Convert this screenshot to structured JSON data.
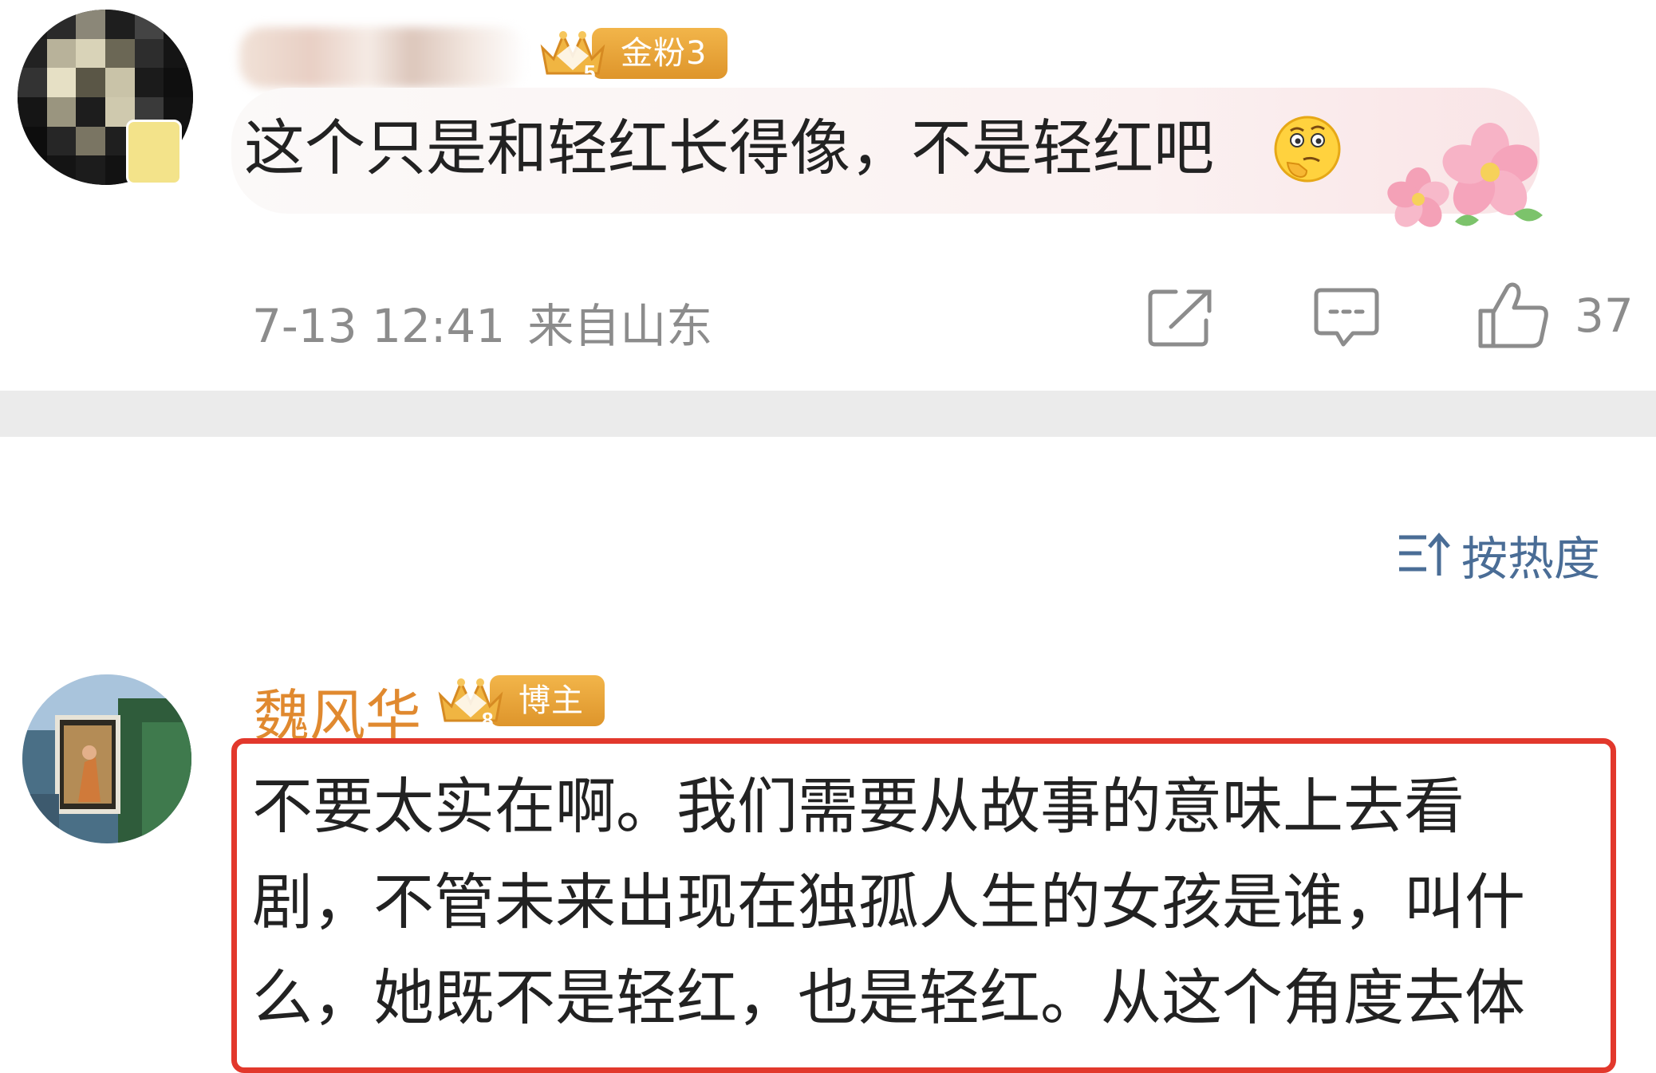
{
  "comment_1": {
    "username": "",
    "fan_badge": {
      "level": "5",
      "label": "金粉3"
    },
    "text": "这个只是和轻红长得像，不是轻红吧",
    "emoji": "thinking-face-icon",
    "time": "7-13 12:41",
    "location": "来自山东",
    "likes": "37"
  },
  "sort": {
    "label": "按热度"
  },
  "comment_2": {
    "username": "魏风华",
    "badge": {
      "level": "8",
      "label": "博主"
    },
    "text_lines": [
      "不要太实在啊。我们需要从故事的意味上去看",
      "剧，不管未来出现在独孤人生的女孩是谁，叫什",
      "么，她既不是轻红，也是轻红。从这个角度去体"
    ]
  },
  "colors": {
    "badge_orange": "#e3982d",
    "blogger_name": "#e0892f",
    "meta_gray": "#8c8c8c",
    "sort_blue": "#4a6d96",
    "highlight_red": "#e2382c"
  }
}
